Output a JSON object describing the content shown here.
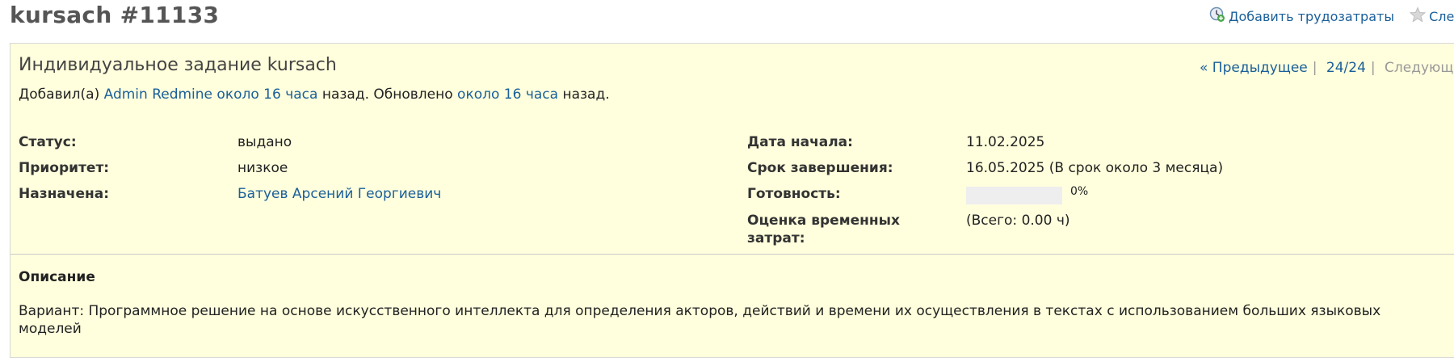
{
  "header": {
    "title": "kursach #11133",
    "actions": {
      "log_time_label": "Добавить трудозатраты",
      "watch_label": "Сле"
    }
  },
  "issue": {
    "subject": "Индивидуальное задание kursach",
    "nav": {
      "prev_label": "« Предыдущее",
      "position": "24/24",
      "next_label": "Следующе"
    },
    "author_line": {
      "added_by_prefix": "Добавил(а)",
      "author": "Admin Redmine",
      "created_ago": "около 16 часа",
      "middle": "назад. Обновлено",
      "updated_ago": "около 16 часа",
      "suffix": "назад."
    },
    "attributes_left": {
      "status_label": "Статус:",
      "status_value": "выдано",
      "priority_label": "Приоритет:",
      "priority_value": "низкое",
      "assignee_label": "Назначена:",
      "assignee_value": "Батуев Арсений Георгиевич"
    },
    "attributes_right": {
      "start_label": "Дата начала:",
      "start_value": "11.02.2025",
      "due_label": "Срок завершения:",
      "due_value": "16.05.2025 (В срок около 3 месяца)",
      "done_label": "Готовность:",
      "done_percent": 0,
      "done_text": "0%",
      "estimate_label_line1": "Оценка временных",
      "estimate_label_line2": "затрат:",
      "estimate_value": "(Всего: 0.00 ч)"
    },
    "description": {
      "heading": "Описание",
      "text": "Вариант: Программное решение на основе искусственного интеллекта для определения акторов, действий и времени их осуществления в текстах с использованием больших языковых моделей"
    }
  },
  "colors": {
    "issue_background": "#ffffdd",
    "link": "#1a5f99",
    "progress_track": "#eeeeee",
    "progress_fill": "#bae0ba"
  }
}
